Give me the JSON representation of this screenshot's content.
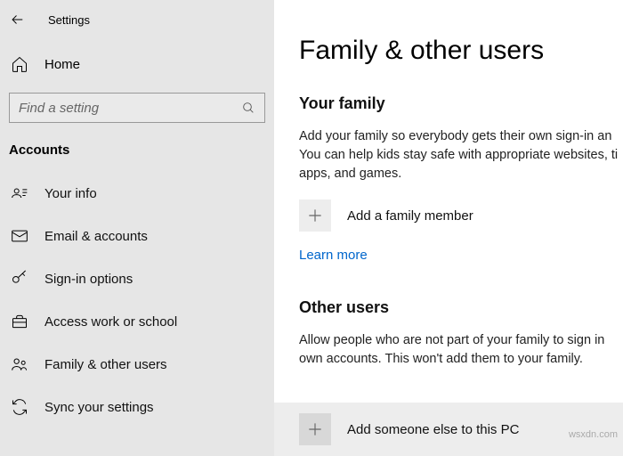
{
  "header": {
    "title": "Settings"
  },
  "home": {
    "label": "Home"
  },
  "search": {
    "placeholder": "Find a setting"
  },
  "section_label": "Accounts",
  "nav": [
    {
      "label": "Your info"
    },
    {
      "label": "Email & accounts"
    },
    {
      "label": "Sign-in options"
    },
    {
      "label": "Access work or school"
    },
    {
      "label": "Family & other users"
    },
    {
      "label": "Sync your settings"
    }
  ],
  "main": {
    "heading": "Family & other users",
    "family": {
      "title": "Your family",
      "text": "Add your family so everybody gets their own sign-in an You can help kids stay safe with appropriate websites, ti apps, and games.",
      "add_label": "Add a family member",
      "learn_more": "Learn more"
    },
    "other": {
      "title": "Other users",
      "text": "Allow people who are not part of your family to sign in own accounts. This won't add them to your family.",
      "add_label": "Add someone else to this PC"
    }
  },
  "watermark": "wsxdn.com"
}
